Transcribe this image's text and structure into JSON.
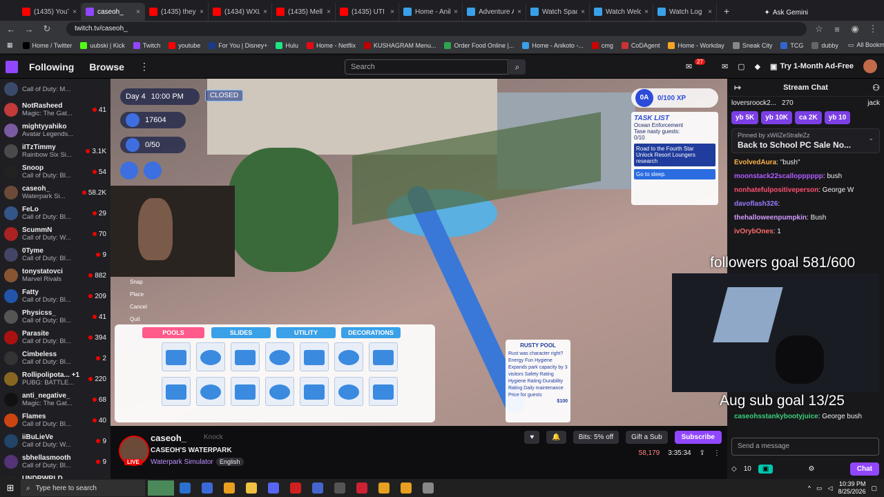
{
  "browser": {
    "tabs": [
      {
        "title": "(1435) YouTub",
        "color": "#ff0000"
      },
      {
        "title": "caseoh_",
        "color": "#9147ff",
        "active": true
      },
      {
        "title": "(1435) they I",
        "color": "#ff0000"
      },
      {
        "title": "(1434) WXLT",
        "color": "#ff0000"
      },
      {
        "title": "(1435) Mell",
        "color": "#ff0000"
      },
      {
        "title": "(1435) UTI N",
        "color": "#ff0000"
      },
      {
        "title": "Home - Anik",
        "color": "#3aa0e8"
      },
      {
        "title": "Adventure A",
        "color": "#3aa0e8"
      },
      {
        "title": "Watch Spac",
        "color": "#3aa0e8"
      },
      {
        "title": "Watch Welc",
        "color": "#3aa0e8"
      },
      {
        "title": "Watch Log H",
        "color": "#3aa0e8"
      }
    ],
    "ask_gemini": "Ask Gemini",
    "url": "twitch.tv/caseoh_",
    "bookmarks": [
      {
        "label": "Home / Twitter",
        "color": "#000000"
      },
      {
        "label": "uubski | Kick",
        "color": "#53fc18"
      },
      {
        "label": "Twitch",
        "color": "#9147ff"
      },
      {
        "label": "youtube",
        "color": "#ff0000"
      },
      {
        "label": "For You | Disney+",
        "color": "#1a3a8a"
      },
      {
        "label": "Hulu",
        "color": "#1ce783"
      },
      {
        "label": "Home - Netflix",
        "color": "#e50914"
      },
      {
        "label": "KUSHAGRAM Menu...",
        "color": "#c00000"
      },
      {
        "label": "Order Food Online |...",
        "color": "#2ea44f"
      },
      {
        "label": "Home - Anikoto -...",
        "color": "#3aa0e8"
      },
      {
        "label": "cmg",
        "color": "#cc0000"
      },
      {
        "label": "CoDAgent",
        "color": "#cc3333"
      },
      {
        "label": "Home - Workday",
        "color": "#f5a623"
      },
      {
        "label": "Sneak City",
        "color": "#888888"
      },
      {
        "label": "TCG",
        "color": "#3366cc"
      },
      {
        "label": "dubby",
        "color": "#666666"
      }
    ],
    "all_bookmarks": "All Bookmarks"
  },
  "twitch": {
    "nav": {
      "following": "Following",
      "browse": "Browse",
      "search_placeholder": "Search",
      "notif_count": "27",
      "ad_free": "Try 1-Month Ad-Free"
    },
    "sidebar": [
      {
        "name": "",
        "game": "Call of Duty: M...",
        "viewers": "",
        "color": "#3a4a6a"
      },
      {
        "name": "NotRasheed",
        "game": "Magic: The Gat...",
        "viewers": "41",
        "color": "#c23a3a"
      },
      {
        "name": "mightyyahiko",
        "game": "Avatar Legends...",
        "viewers": "",
        "color": "#7a5aa0"
      },
      {
        "name": "iITzTimmy",
        "game": "Rainbow Six Si...",
        "viewers": "3.1K",
        "color": "#4a4a4a"
      },
      {
        "name": "Snoop",
        "game": "Call of Duty: Bl...",
        "viewers": "54",
        "color": "#222222"
      },
      {
        "name": "caseoh_",
        "game": "Waterpark Si...",
        "viewers": "58.2K",
        "color": "#6b4a3a"
      },
      {
        "name": "FeLo",
        "game": "Call of Duty: Bl...",
        "viewers": "29",
        "color": "#335588"
      },
      {
        "name": "ScummN",
        "game": "Call of Duty: W...",
        "viewers": "70",
        "color": "#aa2222"
      },
      {
        "name": "0Tyme",
        "game": "Call of Duty: Bl...",
        "viewers": "9",
        "color": "#444466"
      },
      {
        "name": "tonystatovci",
        "game": "Marvel Rivals",
        "viewers": "882",
        "color": "#885533"
      },
      {
        "name": "Fatty",
        "game": "Call of Duty: Bl...",
        "viewers": "209",
        "color": "#2255aa"
      },
      {
        "name": "Physicss_",
        "game": "Call of Duty: Bl...",
        "viewers": "41",
        "color": "#555555"
      },
      {
        "name": "Parasite",
        "game": "Call of Duty: Bl...",
        "viewers": "394",
        "color": "#aa1111"
      },
      {
        "name": "Cimbeless",
        "game": "Call of Duty: Bl...",
        "viewers": "2",
        "color": "#333333"
      },
      {
        "name": "Rollipolipota... +1",
        "game": "PUBG: BATTLE...",
        "viewers": "220",
        "color": "#886622"
      },
      {
        "name": "anti_negative_",
        "game": "Magic: The Gat...",
        "viewers": "68",
        "color": "#111111"
      },
      {
        "name": "Flames",
        "game": "Call of Duty: Bl...",
        "viewers": "40",
        "color": "#cc4411"
      },
      {
        "name": "iiBuLieVe",
        "game": "Call of Duty: W...",
        "viewers": "9",
        "color": "#224466"
      },
      {
        "name": "sbhellasmooth",
        "game": "Call of Duty: Bl...",
        "viewers": "9",
        "color": "#553377"
      },
      {
        "name": "UNDRWRLD_",
        "game": "Marvel Rivals",
        "viewers": "8",
        "color": "#222222"
      }
    ],
    "game": {
      "day": "Day 4",
      "time": "10:00 PM",
      "status": "CLOSED",
      "money": "17604",
      "guests": "0/50",
      "xp_level": "0A",
      "xp": "0/100 XP",
      "task_title": "TASK LIST",
      "task1": "Ocean Enforcement",
      "task1b": "Tase nasty guests:",
      "task1c": "0/10",
      "task2": "Road to the Fourth Star",
      "task2b": "Unlock Resort Loungers research",
      "task3": "Go to sleep.",
      "controls": [
        "Snap",
        "Place",
        "Cancel",
        "Quit"
      ],
      "build_tabs": [
        "POOLS",
        "SLIDES",
        "UTILITY",
        "DECORATIONS"
      ],
      "rusty_title": "RUSTY POOL",
      "rusty_desc": "Rust was character right? Energy Fun Hygiene Expands park capacity by 3 visitors Safety Rating Hygiene Rating Durability Rating Daily maintenance Price for guests",
      "rusty_price": "$100"
    },
    "overlay": {
      "followers": "followers goal 581/600",
      "subs": "Aug sub goal 13/25"
    },
    "chat": {
      "title": "Stream Chat",
      "hype_user": "loversroock2...",
      "hype_count": "270",
      "hype_user2": "jack",
      "chips": [
        "yb 5K",
        "yb 10K",
        "ca 2K",
        "yb 10"
      ],
      "pinned_by": "Pinned by xWiIZeStrafeZz",
      "pinned_text": "Back to School PC Sale No...",
      "messages": [
        {
          "user": "EvolvedAura",
          "color": "#ffb347",
          "text": "\"bush\""
        },
        {
          "user": "moonstack22scallopppppp",
          "color": "#b05cff",
          "text": "bush"
        },
        {
          "user": "nonhatefulpositiveperson",
          "color": "#ff4f6e",
          "text": "George W"
        },
        {
          "user": "davoflash326",
          "color": "#9a7bff",
          "text": ""
        },
        {
          "user": "thehalloweenpumpkin",
          "color": "#d49bff",
          "text": "Bush"
        },
        {
          "user": "ivOrybOnes",
          "color": "#ff6b6b",
          "text": "1"
        }
      ],
      "last_user": "caseohsstankybootyjuice",
      "last_text": "George bush",
      "input_placeholder": "Send a message",
      "points": "10",
      "chat_button": "Chat"
    },
    "info": {
      "channel": "caseoh_",
      "knock": "Knock",
      "title": "CASEOH'S WATERPARK",
      "game": "Waterpark Simulator",
      "lang": "English",
      "bits": "Bits: 5% off",
      "gift": "Gift a Sub",
      "subscribe": "Subscribe",
      "viewers": "58,179",
      "uptime": "3:35:34"
    }
  },
  "taskbar": {
    "search": "Type here to search",
    "time": "10:39 PM",
    "date": "8/25/2026"
  }
}
